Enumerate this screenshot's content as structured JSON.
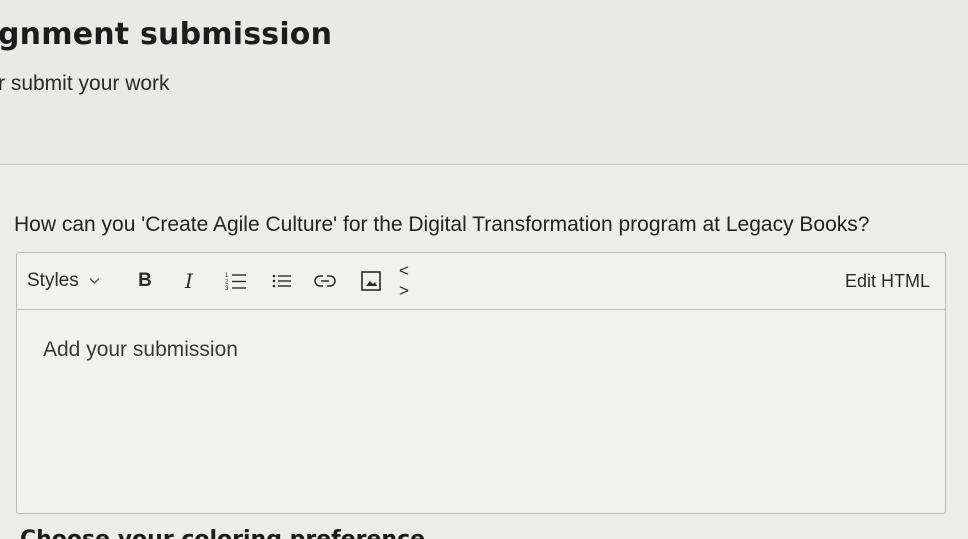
{
  "header": {
    "title": "gnment submission",
    "subtitle": "r submit your work"
  },
  "question": {
    "text": "How can you 'Create Agile Culture' for the Digital Transformation program at Legacy Books?"
  },
  "editor": {
    "toolbar": {
      "styles_label": "Styles",
      "bold_label": "B",
      "italic_label": "I",
      "code_label": "< >",
      "edit_html_label": "Edit HTML"
    },
    "placeholder": "Add your submission"
  },
  "next_section": {
    "title": "Choose your coloring preference"
  }
}
